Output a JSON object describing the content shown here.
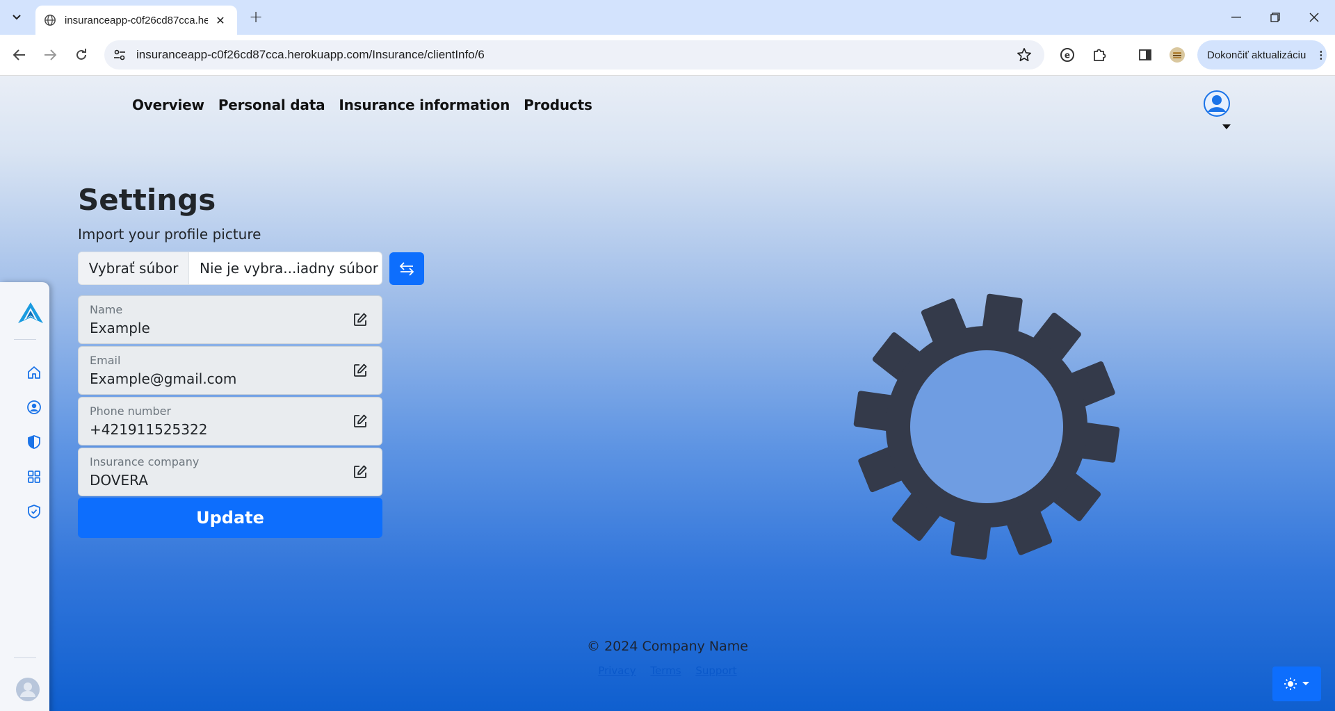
{
  "browser": {
    "tab_title": "insuranceapp-c0f26cd87cca.herokuapp.com",
    "url": "insuranceapp-c0f26cd87cca.herokuapp.com/Insurance/clientInfo/6",
    "update_label": "Dokončiť aktualizáciu"
  },
  "nav": {
    "items": [
      "Overview",
      "Personal data",
      "Insurance information",
      "Products"
    ]
  },
  "settings": {
    "title": "Settings",
    "import_label": "Import your profile picture",
    "file_button": "Vybrať súbor",
    "file_status": "Nie je vybra...iadny súbor",
    "fields": [
      {
        "label": "Name",
        "value": "Example"
      },
      {
        "label": "Email",
        "value": "Example@gmail.com"
      },
      {
        "label": "Phone number",
        "value": "+421911525322"
      },
      {
        "label": "Insurance company",
        "value": "DOVERA"
      }
    ],
    "update_button": "Update"
  },
  "footer": {
    "copyright": "© 2024 Company Name",
    "links": [
      "Privacy",
      "Terms",
      "Support"
    ]
  },
  "colors": {
    "accent": "#0d6efd",
    "gear": "#343a4a"
  }
}
